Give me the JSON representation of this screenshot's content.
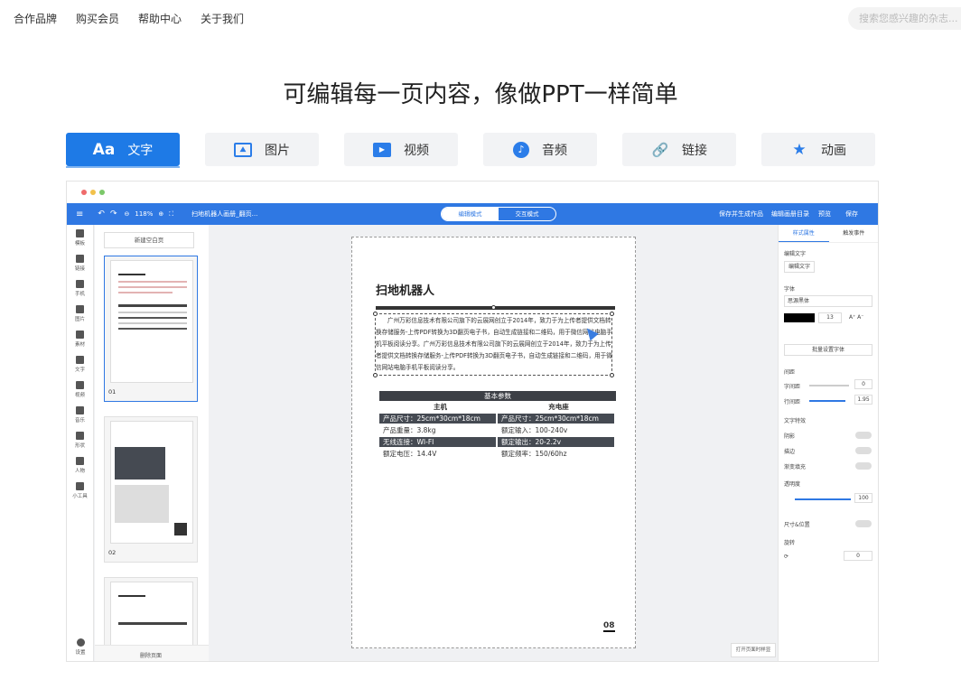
{
  "nav": {
    "links": [
      "合作品牌",
      "购买会员",
      "帮助中心",
      "关于我们"
    ],
    "search_placeholder": "搜索您感兴趣的杂志..."
  },
  "headline": "可编辑每一页内容，像做PPT一样简单",
  "tabs": [
    {
      "label": "文字",
      "icon": "Aa",
      "active": true
    },
    {
      "label": "图片",
      "icon": "image-icon"
    },
    {
      "label": "视频",
      "icon": "video-icon"
    },
    {
      "label": "音频",
      "icon": "audio-icon"
    },
    {
      "label": "链接",
      "icon": "link-icon"
    },
    {
      "label": "动画",
      "icon": "star-icon"
    }
  ],
  "editor": {
    "zoom": "118%",
    "doc_name": "扫地机器人画册_翻页...",
    "mode_edit": "编辑模式",
    "mode_interact": "交互模式",
    "right_tools": [
      "保存并生成作品",
      "编辑画册目录",
      "预览",
      "保存"
    ],
    "rail": [
      "模板",
      "链接",
      "手机",
      "图片",
      "素材",
      "文字",
      "视频",
      "音乐",
      "形状",
      "人物",
      "小工具",
      "设置"
    ],
    "new_page": "新建空白页",
    "page_numbers": [
      "01",
      "02"
    ],
    "delete_page": "删除页面",
    "doc": {
      "title": "扫地机器人",
      "body": "广州万彩信息技术有限公司旗下的云展网创立于2014年，致力于为上传者提供文档转换存储服务-上传PDF转换为3D翻页电子书，自动生成链接和二维码，用于微信网站电脑手机平板阅读分享。广州万彩信息技术有限公司旗下的云展网创立于2014年，致力于为上传者提供文档转换存储服务-上传PDF转换为3D翻页电子书，自动生成链接和二维码，用于微信网站电脑手机平板阅读分享。",
      "spec_title": "基本参数",
      "spec_cols": [
        "主机",
        "充电座"
      ],
      "spec_rows": [
        [
          "产品尺寸：25cm*30cm*18cm",
          "产品尺寸：25cm*30cm*18cm"
        ],
        [
          "产品重量：3.8kg",
          "额定输入：100-240v"
        ],
        [
          "无线连接：WI-FI",
          "额定输出：20-2.2v"
        ],
        [
          "额定电压：14.4V",
          "额定频率：150/60hz"
        ]
      ],
      "page_number": "08"
    },
    "panel": {
      "tabs": [
        "样式属性",
        "触发事件"
      ],
      "edit_text": "编辑文字",
      "edit_button": "编辑文字",
      "font_label": "字体",
      "font_value": "思源黑体",
      "font_size": "13",
      "batch": "批量设置字体",
      "spacing": "间距",
      "char_spacing": "字间距",
      "char_spacing_val": "0",
      "line_spacing": "行间距",
      "line_spacing_val": "1.95",
      "effects": "文字特效",
      "shadow": "阴影",
      "stroke": "描边",
      "gradient": "渐变填充",
      "opacity": "透明度",
      "opacity_val": "100",
      "size_pos": "尺寸&位置",
      "rotate": "旋转",
      "rotate_val": "0"
    },
    "footer_btn": "打开页面时样显"
  },
  "colors": {
    "primary": "#1e7ae6",
    "toolbar": "#2f78e3"
  }
}
